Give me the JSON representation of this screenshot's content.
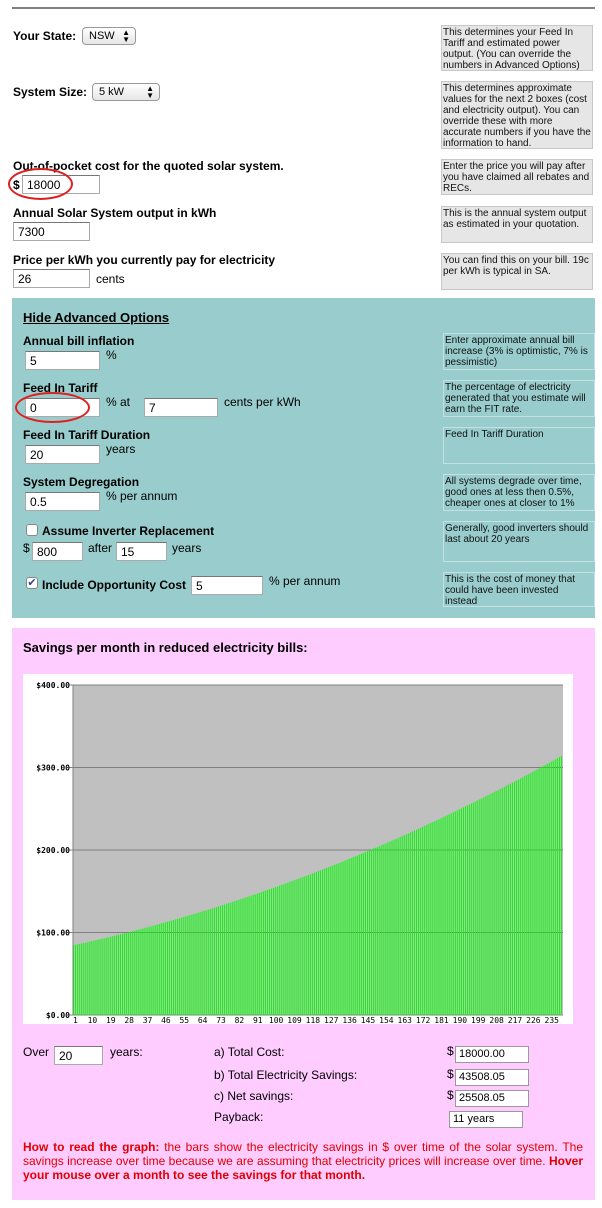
{
  "basic": {
    "state_label": "Your State:",
    "state_value": "NSW",
    "size_label": "System Size:",
    "size_value": "5 kW",
    "cost_label": "Out-of-pocket cost for the quoted solar system.",
    "cost_currency": "$",
    "cost_value": "18000",
    "output_label": "Annual Solar System output in kWh",
    "output_value": "7300",
    "price_label": "Price per kWh you currently pay for electricity",
    "price_value": "26",
    "price_unit": "cents",
    "help": [
      "This determines your Feed In Tariff and estimated power output. (You can override the numbers in Advanced Options)",
      "This determines approximate values for the next 2 boxes (cost and electricity output). You can override these with more accurate numbers if you have the information to hand.",
      "Enter the price you will pay after you have claimed all rebates and RECs.",
      "This is the annual system output as estimated in your quotation.",
      "You can find this on your bill. 19c per kWh is typical in SA."
    ]
  },
  "advanced": {
    "toggle_label": "Hide Advanced Options",
    "inflation_label": "Annual bill inflation",
    "inflation_value": "5",
    "inflation_unit": "%",
    "fit_label": "Feed In Tariff",
    "fit_percent": "0",
    "fit_at": "% at",
    "fit_rate": "7",
    "fit_unit": "cents per kWh",
    "fit_duration_label": "Feed In Tariff Duration",
    "fit_duration_value": "20",
    "fit_duration_unit": "years",
    "degradation_label": "System Degregation",
    "degradation_value": "0.5",
    "degradation_unit": "% per annum",
    "inverter_label": "Assume Inverter Replacement",
    "inverter_checked": false,
    "inverter_currency": "$",
    "inverter_cost": "800",
    "inverter_after": "after",
    "inverter_years": "15",
    "inverter_unit": "years",
    "opp_label": "Include Opportunity Cost",
    "opp_checked": true,
    "opp_value": "5",
    "opp_unit": "% per annum",
    "help": [
      "Enter approximate annual bill increase (3% is optimistic, 7% is pessimistic)",
      "The percentage of electricity generated that you estimate will earn the FIT rate.",
      "Feed In Tariff Duration",
      "All systems degrade over time, good ones at less then 0.5%, cheaper ones at closer to 1%",
      "Generally, good inverters should last about 20 years",
      "This is the cost of money that could have been invested instead"
    ]
  },
  "results": {
    "heading": "Savings per month in reduced electricity bills:",
    "over_label": "Over",
    "over_value": "20",
    "over_unit": "years:",
    "total_cost_label": "a) Total Cost:",
    "total_cost": "18000.00",
    "savings_label": "b) Total Electricity Savings:",
    "savings": "43508.05",
    "net_label": "c) Net savings:",
    "net": "25508.05",
    "payback_label": "Payback:",
    "payback": "11 years",
    "currency": "$",
    "note_bold1": "How to read the graph:",
    "note_text": " the bars show the electricity savings in $ over time of the solar system. The savings increase over time because we are assuming that electricity prices will increase over time. ",
    "note_bold2": "Hover your mouse over a month to see the savings for that month."
  },
  "colors": {
    "accent_red": "#e00000",
    "advanced_bg": "#99cccc",
    "results_bg": "#ffccff",
    "bar": "#00ff00",
    "plot_bg": "#c0c0c0"
  },
  "chart_data": {
    "type": "bar",
    "ylim": [
      0,
      400
    ],
    "grid": true,
    "yticks": [
      "$0.00",
      "$100.00",
      "$200.00",
      "$300.00",
      "$400.00"
    ],
    "xticks": [
      "1",
      "10",
      "19",
      "28",
      "37",
      "46",
      "55",
      "64",
      "73",
      "82",
      "91",
      "100",
      "109",
      "118",
      "127",
      "136",
      "145",
      "154",
      "163",
      "172",
      "181",
      "190",
      "199",
      "208",
      "217",
      "226",
      "235"
    ],
    "values": [
      84.6,
      85.1,
      85.7,
      86.2,
      86.8,
      87.3,
      87.9,
      88.4,
      89.0,
      89.5,
      90.1,
      90.7,
      91.3,
      91.9,
      92.5,
      93.0,
      93.6,
      94.2,
      94.8,
      95.4,
      96.0,
      96.6,
      97.3,
      97.9,
      98.5,
      99.1,
      99.7,
      100.4,
      101.0,
      101.6,
      102.3,
      102.9,
      103.6,
      104.2,
      104.9,
      105.6,
      106.2,
      106.9,
      107.5,
      108.2,
      108.9,
      109.6,
      110.3,
      111.0,
      111.7,
      112.3,
      113.0,
      113.7,
      114.4,
      115.1,
      115.8,
      116.6,
      117.3,
      118.0,
      118.8,
      119.5,
      120.2,
      120.9,
      121.7,
      122.4,
      123.2,
      123.9,
      124.7,
      125.4,
      126.2,
      127.0,
      127.7,
      128.5,
      129.2,
      130.0,
      130.8,
      131.6,
      132.4,
      133.2,
      134.0,
      134.8,
      135.6,
      136.4,
      137.2,
      138.0,
      138.8,
      139.7,
      140.5,
      141.3,
      142.2,
      143.0,
      143.8,
      144.6,
      145.5,
      146.3,
      147.2,
      148.0,
      148.9,
      149.8,
      150.7,
      151.5,
      152.4,
      153.3,
      154.1,
      155.0,
      155.9,
      156.8,
      157.7,
      158.6,
      159.6,
      160.5,
      161.4,
      162.3,
      163.2,
      164.1,
      165.0,
      166.0,
      166.9,
      167.9,
      168.8,
      169.7,
      170.7,
      171.6,
      172.6,
      173.5,
      174.5,
      175.4,
      176.4,
      177.4,
      178.4,
      179.3,
      180.3,
      181.3,
      182.2,
      183.2,
      184.2,
      185.2,
      186.2,
      187.2,
      188.3,
      189.3,
      190.3,
      191.3,
      192.3,
      193.3,
      194.4,
      195.4,
      196.5,
      197.5,
      198.6,
      199.6,
      200.7,
      201.7,
      202.8,
      203.8,
      204.9,
      206.0,
      207.0,
      208.1,
      209.2,
      210.3,
      211.4,
      212.4,
      213.5,
      214.6,
      215.7,
      216.8,
      218.0,
      219.1,
      220.2,
      221.3,
      222.4,
      223.6,
      224.7,
      225.8,
      227.0,
      228.1,
      229.3,
      230.4,
      231.6,
      232.7,
      233.9,
      235.0,
      236.2,
      237.3,
      238.5,
      239.7,
      240.9,
      242.1,
      243.3,
      244.4,
      245.6,
      246.8,
      248.0,
      249.2,
      250.4,
      251.6,
      252.9,
      254.1,
      255.3,
      256.5,
      257.7,
      259.0,
      260.2,
      261.4,
      262.7,
      263.9,
      265.2,
      266.4,
      267.7,
      269.0,
      270.2,
      271.5,
      272.7,
      274.0,
      275.3,
      276.6,
      277.9,
      279.2,
      280.5,
      281.7,
      283.0,
      284.3,
      285.6,
      286.9,
      288.2,
      289.6,
      290.9,
      292.2,
      293.6,
      294.9,
      296.2,
      297.5,
      298.9,
      300.2,
      301.6,
      302.9,
      304.3,
      305.7,
      307.0,
      308.4,
      309.8,
      311.2,
      312.5,
      313.9
    ]
  }
}
